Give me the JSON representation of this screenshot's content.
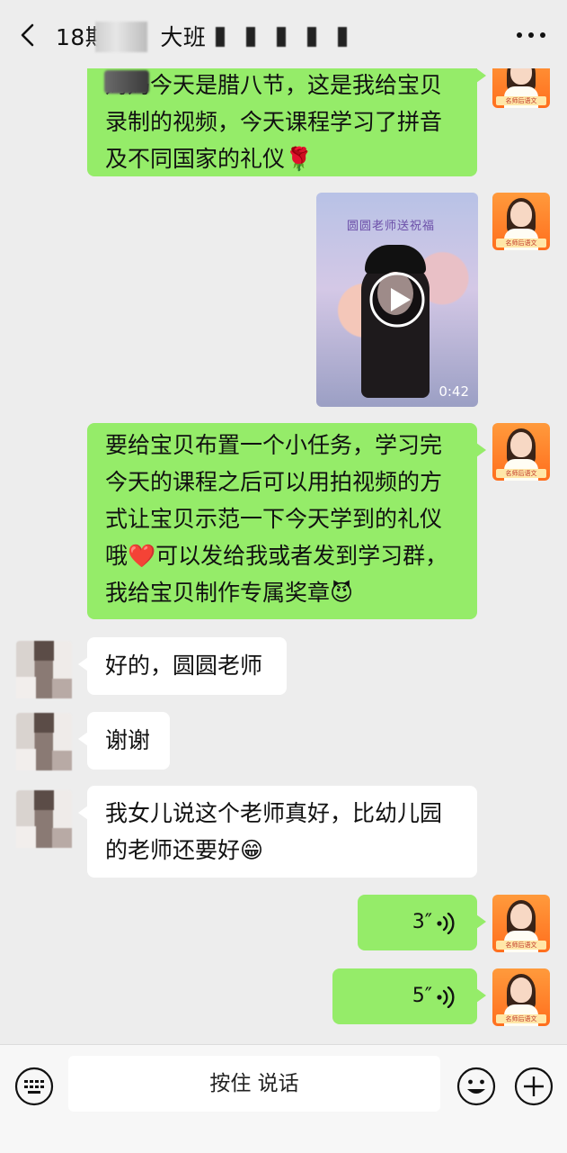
{
  "header": {
    "title_prefix": "18期",
    "title_suffix": "大班"
  },
  "messages": [
    {
      "side": "right",
      "text": "妈妈今天是腊八节，这是我给宝贝录制的视频，今天课程学习了拼音及不同国家的礼仪🌹"
    },
    {
      "side": "right",
      "type": "video",
      "caption": "圆圆老师送祝福",
      "duration": "0:42"
    },
    {
      "side": "right",
      "text": "要给宝贝布置一个小任务，学习完今天的课程之后可以用拍视频的方式让宝贝示范一下今天学到的礼仪哦❤️可以发给我或者发到学习群，我给宝贝制作专属奖章😈"
    },
    {
      "side": "left",
      "text": "好的，圆圆老师"
    },
    {
      "side": "left",
      "text": "谢谢"
    },
    {
      "side": "left",
      "text": "我女儿说这个老师真好，比幼儿园的老师还要好😁"
    },
    {
      "side": "right",
      "type": "voice",
      "duration": "3″"
    },
    {
      "side": "right",
      "type": "voice",
      "duration": "5″"
    }
  ],
  "avatar_tag": "名师后语文",
  "input_bar": {
    "hold_to_talk": "按住 说话"
  },
  "icons": {
    "back": "chevron-left-icon",
    "more": "more-dots-icon",
    "play": "play-icon",
    "voice": "voice-wave-icon",
    "keyboard": "keyboard-icon",
    "emoji": "emoji-icon",
    "plus": "plus-icon"
  },
  "colors": {
    "background": "#ededed",
    "sent_bubble": "#95ec69",
    "received_bubble": "#ffffff",
    "avatar_bg": "#ff7a22"
  }
}
